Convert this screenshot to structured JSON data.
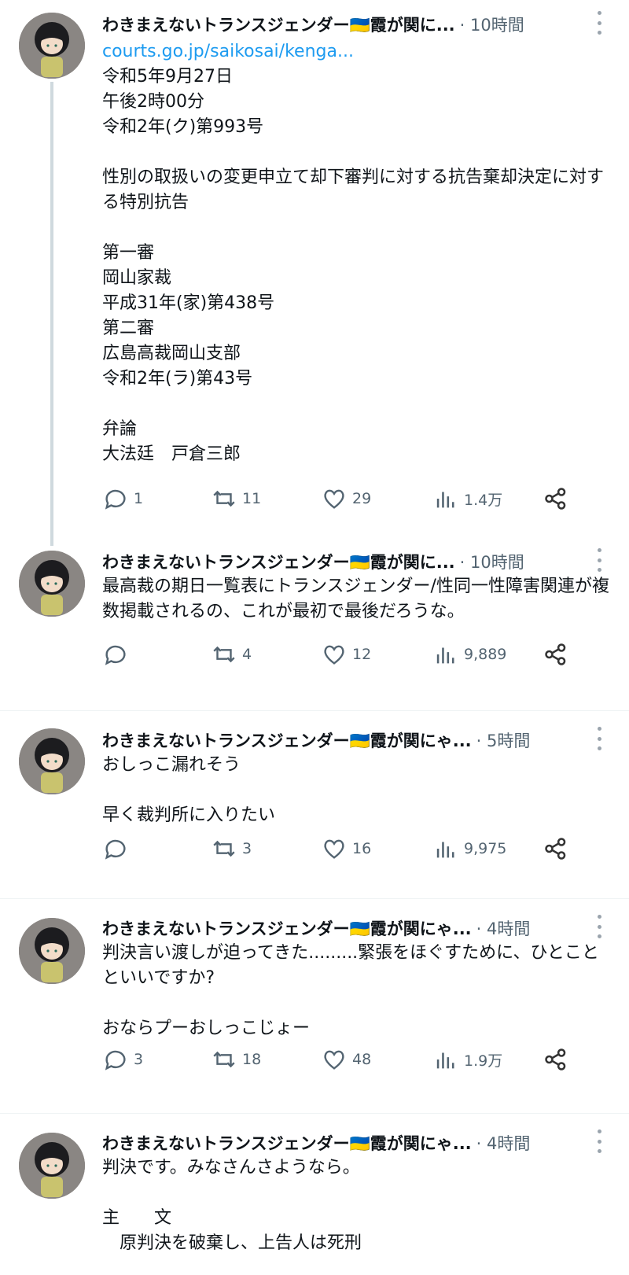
{
  "posts": [
    {
      "author": "わきまえないトランスジェンダー🇺🇦霞が関に...",
      "time": "· 10時間",
      "link": "courts.go.jp/saikosai/kenga...",
      "text": "令和5年9月27日\n午後2時00分\n令和2年(ク)第993号\n\n性別の取扱いの変更申立て却下審判に対する抗告棄却決定に対する特別抗告\n\n第一審\n岡山家裁\n平成31年(家)第438号\n第二審\n広島高裁岡山支部\n令和2年(ラ)第43号\n\n弁論\n大法廷　戸倉三郎",
      "replies": "1",
      "retweets": "11",
      "likes": "29",
      "views": "1.4万"
    },
    {
      "author": "わきまえないトランスジェンダー🇺🇦霞が関に...",
      "time": "· 10時間",
      "text": "最高裁の期日一覧表にトランスジェンダー/性同一性障害関連が複数掲載されるの、これが最初で最後だろうな。",
      "replies": "",
      "retweets": "4",
      "likes": "12",
      "views": "9,889"
    },
    {
      "author": "わきまえないトランスジェンダー🇺🇦霞が関にゃ...",
      "time": "· 5時間",
      "text": "おしっこ漏れそう\n\n早く裁判所に入りたい",
      "replies": "",
      "retweets": "3",
      "likes": "16",
      "views": "9,975"
    },
    {
      "author": "わきまえないトランスジェンダー🇺🇦霞が関にゃ...",
      "time": "· 4時間",
      "text": "判決言い渡しが迫ってきた.........緊張をほぐすために、ひとことといいですか?\n\nおならプーおしっこじょー",
      "replies": "3",
      "retweets": "18",
      "likes": "48",
      "views": "1.9万"
    },
    {
      "author": "わきまえないトランスジェンダー🇺🇦霞が関にゃ...",
      "time": "· 4時間",
      "text": "判決です。みなさんさようなら。\n\n主　　文\n　原判決を破棄し、上告人は死刑"
    }
  ],
  "icons": {
    "reply": "reply-icon",
    "retweet": "retweet-icon",
    "like": "heart-icon",
    "views": "views-icon",
    "share": "share-icon",
    "more": "more-icon"
  },
  "colors": {
    "link": "#1d9bf0",
    "muted": "#536471",
    "thread_line": "#cfd9de",
    "text": "#0f1419"
  }
}
